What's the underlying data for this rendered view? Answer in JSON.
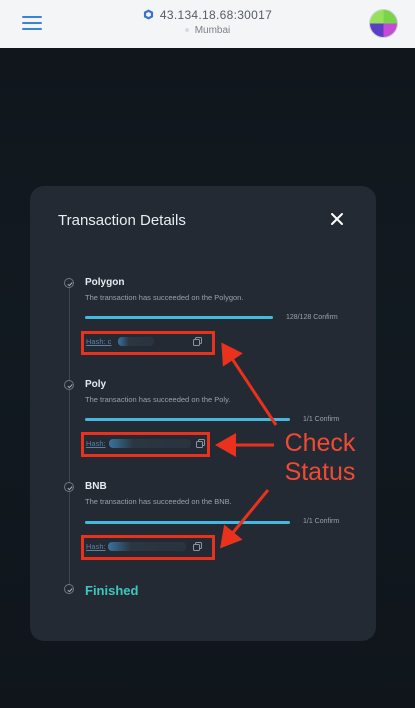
{
  "header": {
    "node_address": "43.134.18.68:30017",
    "region": "Mumbai",
    "menu_icon": "hamburger-icon",
    "node_icon": "node-cube-icon",
    "avatar_icon": "wallet-avatar"
  },
  "modal": {
    "title": "Transaction Details",
    "close_icon": "close-icon",
    "steps": [
      {
        "chain": "Polygon",
        "description": "The transaction has succeeded on the Polygon.",
        "confirm": "128/128 Confirm",
        "progress": 1.0,
        "hash_label": "Hash: c"
      },
      {
        "chain": "Poly",
        "description": "The transaction has succeeded on the Poly.",
        "confirm": "1/1 Confirm",
        "progress": 1.0,
        "hash_label": "Hash:"
      },
      {
        "chain": "BNB",
        "description": "The transaction has succeeded on the BNB.",
        "confirm": "1/1 Confirm",
        "progress": 1.0,
        "hash_label": "Hash:"
      }
    ],
    "finished_label": "Finished"
  },
  "annotation": {
    "line1": "Check",
    "line2": "Status",
    "color": "#e8321d"
  },
  "colors": {
    "accent": "#45b8df",
    "finished": "#3cc8bd",
    "modal_bg": "#232a33"
  }
}
